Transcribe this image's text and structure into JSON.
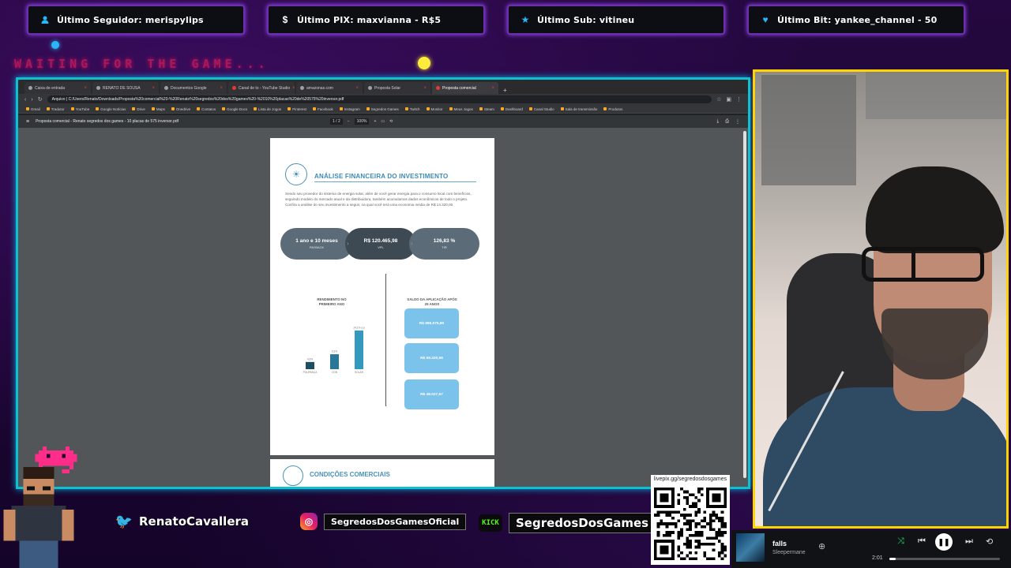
{
  "overlay": {
    "alerts": [
      {
        "icon": "user-icon",
        "text": "Último Seguidor: merispylips"
      },
      {
        "icon": "dollar-icon",
        "text": "Último PIX: maxvianna - R$5"
      },
      {
        "icon": "star-icon",
        "text": "Último Sub: vitineu"
      },
      {
        "icon": "heart-icon",
        "text": "Último Bit: yankee_channel - 50"
      }
    ],
    "waiting_text": "WAITING FOR THE GAME..."
  },
  "browser": {
    "tabs": [
      "Caixa de entrada",
      "RENATO DE SOUSA",
      "Documentos Google",
      "Canal de to - YouTube Studio",
      "amazonas.com",
      "Proposta Solar",
      "Proposta comercial"
    ],
    "url": "Arquivo | C:/Users/Renato/Downloads/Proposta%20comercial%20-%20Renato%20segredos%20dos%20games%20-%2010%20placas%20de%20575%20inversor.pdf",
    "bookmarks": [
      "Gmail",
      "Tradutor",
      "YouTube",
      "Google Notícias",
      "Drive",
      "Maps",
      "Onedrive",
      "Contatos",
      "Google Docs",
      "Lista de Jogos",
      "Pinterest",
      "Facebook",
      "Instagram",
      "Segredos Games",
      "Twitch",
      "Monitor",
      "Meus Jogos",
      "Steam",
      "Dashboard",
      "Canal Studio",
      "Sala de transmissão",
      "Produtos"
    ],
    "pdf_title": "Proposta comercial - Renato segredos dos games - 10 placas de 575 inversor.pdf",
    "pdf_page": "1 / 2",
    "zoom": "100%"
  },
  "pdf": {
    "section_title": "ANÁLISE FINANCEIRA DO INVESTIMENTO",
    "body": "Sendo seu provedor do sistema de energia solar, além de você gerar energia para o consumo local com benefícios, seguindo modelo do mercado atual e da distribuidora, também acumulamos dados econômicos de todo o projeto. Confira a análise do seu investimento a seguir, na qual você terá uma economia média de R$ 14.320,00.",
    "metrics": [
      {
        "value": "1 ano e 10 meses",
        "label": "PAYBACK"
      },
      {
        "value": "R$ 120.465,98",
        "label": "VPL"
      },
      {
        "value": "126,83 %",
        "label": "TIR"
      }
    ],
    "left_heading": "RENDIMENTO NO PRIMEIRO ANO",
    "right_heading": "SALDO DA APLICAÇÃO APÓS 25 ANOS",
    "balances": [
      "R$ 996.075,80",
      "R$ 59.320,56",
      "R$ 48.027,57"
    ],
    "next_section": "CONDIÇÕES COMERCIAIS"
  },
  "chart_data": {
    "type": "bar",
    "categories": [
      "POUPANÇA",
      "CDB",
      "SOLAR"
    ],
    "values": [
      4.5,
      9.3,
      24.1
    ],
    "title": "RENDIMENTO NO PRIMEIRO ANO",
    "xlabel": "",
    "ylabel": "",
    "ylim": [
      0,
      27
    ],
    "data_labels": [
      "4,5%",
      "9,3%",
      "24,1% a.a"
    ],
    "colors": [
      "#1f4e63",
      "#2a7898",
      "#3599bf"
    ]
  },
  "social": {
    "twitter": "RenatoCavallera",
    "instagram": "SegredosDosGamesOficial",
    "kick_badge": "KICK",
    "kick": "SegredosDosGames"
  },
  "qr": {
    "url": "livepix.gg/segredosdosgames"
  },
  "music": {
    "title": "falls",
    "artist": "Sleepermane",
    "time": "2:01",
    "progress": 0.06
  }
}
